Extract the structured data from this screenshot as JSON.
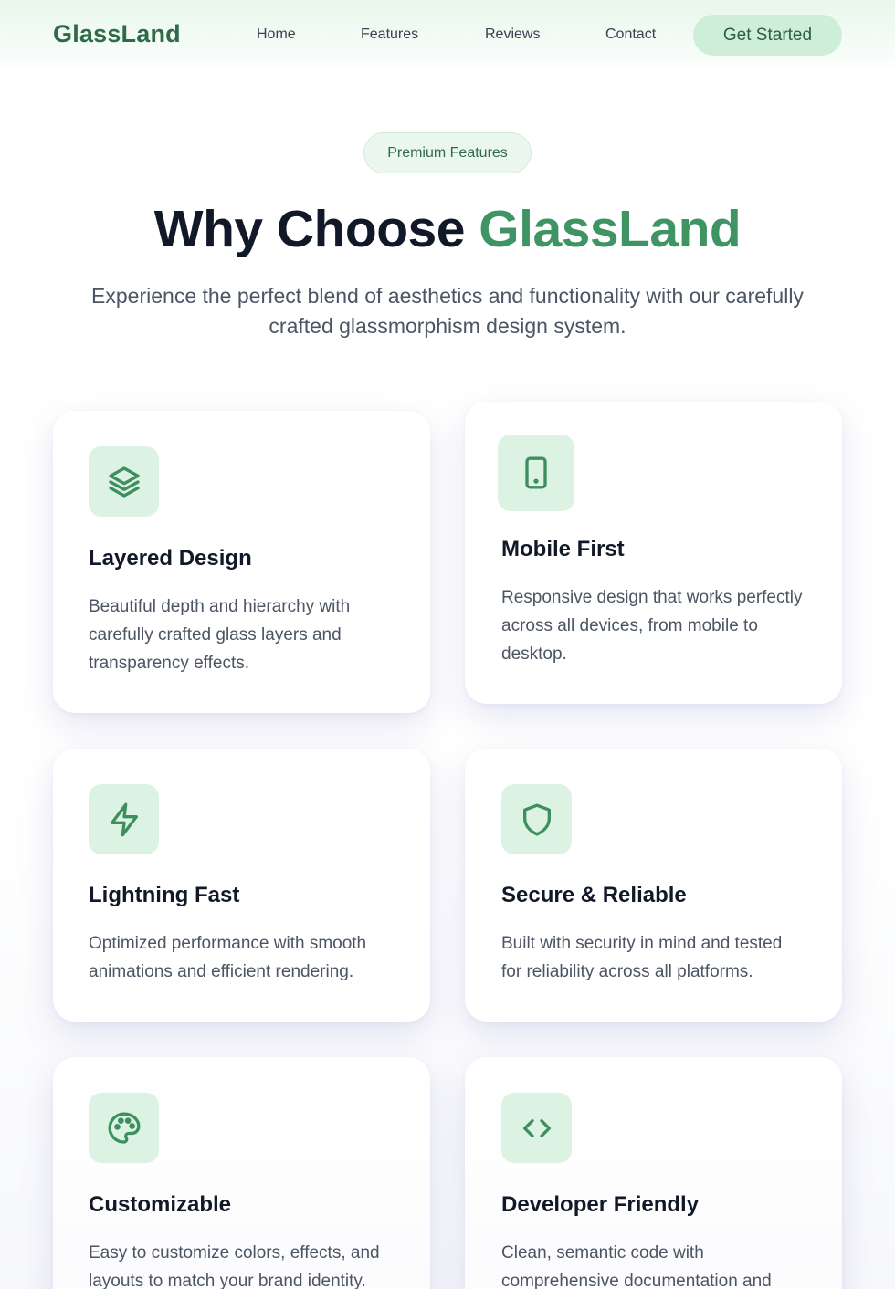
{
  "nav": {
    "brand": "GlassLand",
    "links": [
      "Home",
      "Features",
      "Reviews",
      "Contact"
    ],
    "cta_label": "Get Started"
  },
  "hero": {
    "badge": "Premium Features",
    "headline_part1": "Why Choose ",
    "headline_accent": "GlassLand",
    "subtitle": "Experience the perfect blend of aesthetics and functionality with our carefully crafted glassmorphism design system."
  },
  "features": [
    {
      "icon": "layers-icon",
      "title": "Layered Design",
      "description": "Beautiful depth and hierarchy with carefully crafted glass layers and transparency effects."
    },
    {
      "icon": "mobile-icon",
      "title": "Mobile First",
      "description": "Responsive design that works perfectly across all devices, from mobile to desktop."
    },
    {
      "icon": "lightning-icon",
      "title": "Lightning Fast",
      "description": "Optimized performance with smooth animations and efficient rendering."
    },
    {
      "icon": "shield-icon",
      "title": "Secure & Reliable",
      "description": "Built with security in mind and tested for reliability across all platforms."
    },
    {
      "icon": "palette-icon",
      "title": "Customizable",
      "description": "Easy to customize colors, effects, and layouts to match your brand identity."
    },
    {
      "icon": "code-icon",
      "title": "Developer Friendly",
      "description": "Clean, semantic code with comprehensive documentation and"
    }
  ],
  "colors": {
    "accent": "#3e9463",
    "brand": "#2f6b4a",
    "icon_bg": "#dcf2e2",
    "cta_bg": "#cfeed8"
  }
}
